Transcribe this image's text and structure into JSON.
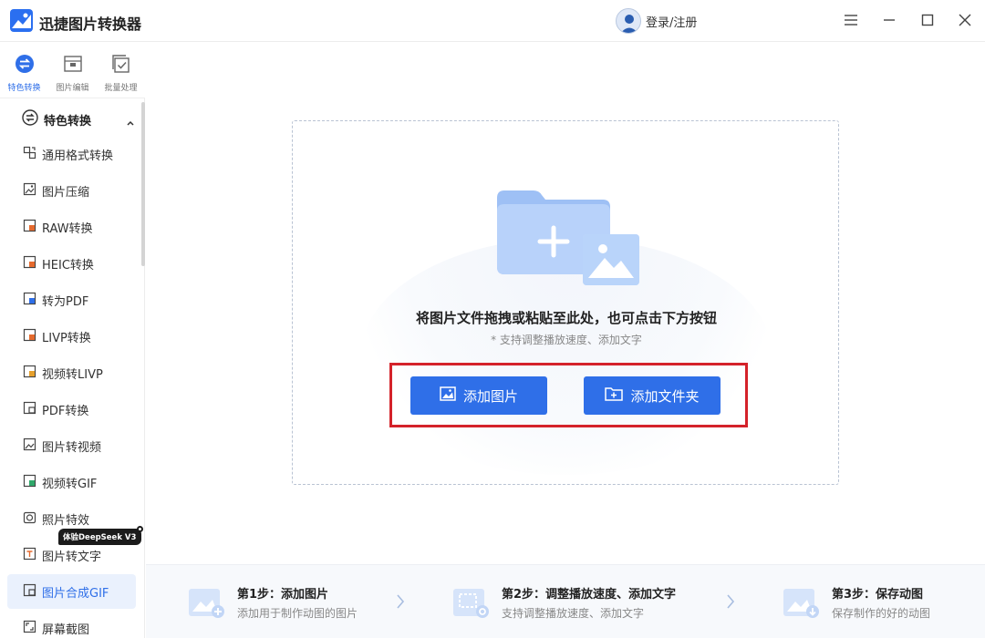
{
  "app": {
    "title": "迅捷图片转换器",
    "login_text": "登录/注册",
    "accent_color": "#2f6fe8"
  },
  "top_tabs": [
    {
      "label": "特色转换",
      "icon": "swap-icon",
      "active": true
    },
    {
      "label": "图片编辑",
      "icon": "image-edit-icon",
      "active": false
    },
    {
      "label": "批量处理",
      "icon": "batch-process-icon",
      "active": false
    }
  ],
  "sidebar": {
    "group_title": "特色转换",
    "items": [
      {
        "label": "通用格式转换",
        "icon": "format-convert-icon"
      },
      {
        "label": "图片压缩",
        "icon": "image-compress-icon"
      },
      {
        "label": "RAW转换",
        "icon": "raw-convert-icon"
      },
      {
        "label": "HEIC转换",
        "icon": "heic-convert-icon"
      },
      {
        "label": "转为PDF",
        "icon": "to-pdf-icon"
      },
      {
        "label": "LIVP转换",
        "icon": "livp-convert-icon"
      },
      {
        "label": "视频转LIVP",
        "icon": "video-to-livp-icon"
      },
      {
        "label": "PDF转换",
        "icon": "pdf-convert-icon"
      },
      {
        "label": "图片转视频",
        "icon": "image-to-video-icon"
      },
      {
        "label": "视频转GIF",
        "icon": "video-to-gif-icon"
      },
      {
        "label": "照片特效",
        "icon": "photo-effect-icon"
      },
      {
        "label": "图片转文字",
        "icon": "image-to-text-icon"
      },
      {
        "label": "图片合成GIF",
        "icon": "image-to-gif-icon",
        "active": true
      },
      {
        "label": "屏幕截图",
        "icon": "screenshot-icon"
      }
    ],
    "badge": "体验DeepSeek V3"
  },
  "drop_zone": {
    "hint": "将图片文件拖拽或粘贴至此处，也可点击下方按钮",
    "sub_hint": "* 支持调整播放速度、添加文字",
    "add_image_label": "添加图片",
    "add_folder_label": "添加文件夹"
  },
  "steps": [
    {
      "title": "第1步：添加图片",
      "desc": "添加用于制作动图的图片"
    },
    {
      "title": "第2步：调整播放速度、添加文字",
      "desc": "支持调整播放速度、添加文字"
    },
    {
      "title": "第3步：保存动图",
      "desc": "保存制作的好的动图"
    }
  ]
}
